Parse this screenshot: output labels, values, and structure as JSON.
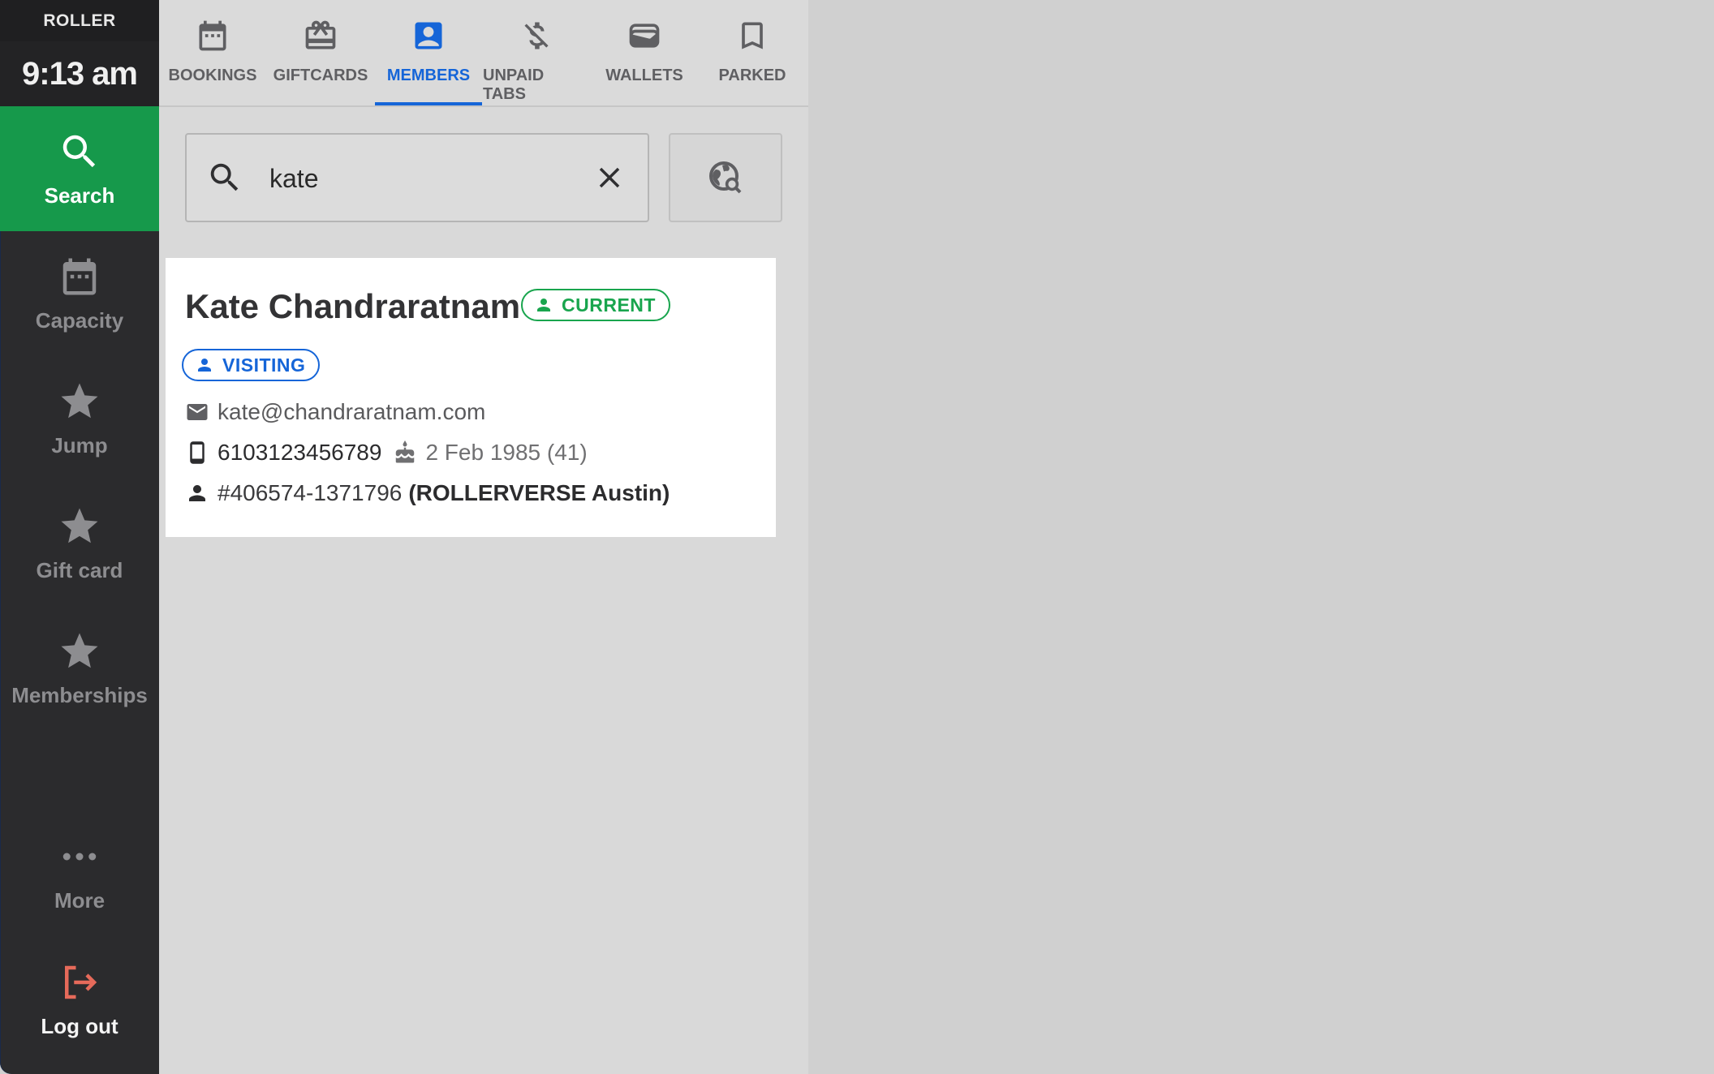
{
  "sidebar": {
    "brand": "ROLLER",
    "time": "9:13 am",
    "items": [
      {
        "label": "Search",
        "icon": "search-icon"
      },
      {
        "label": "Capacity",
        "icon": "calendar-icon"
      },
      {
        "label": "Jump",
        "icon": "star-icon"
      },
      {
        "label": "Gift card",
        "icon": "star-icon"
      },
      {
        "label": "Memberships",
        "icon": "star-icon"
      },
      {
        "label": "More",
        "icon": "more-dots-icon"
      },
      {
        "label": "Log out",
        "icon": "logout-icon"
      }
    ],
    "active_color": "#16994b",
    "logout_color": "#e66a5a"
  },
  "tabs": [
    {
      "label": "BOOKINGS",
      "icon": "calendar-icon"
    },
    {
      "label": "GIFTCARDS",
      "icon": "gift-card-icon"
    },
    {
      "label": "MEMBERS",
      "icon": "member-icon",
      "active": true
    },
    {
      "label": "UNPAID TABS",
      "icon": "no-money-icon"
    },
    {
      "label": "WALLETS",
      "icon": "wallet-icon"
    },
    {
      "label": "PARKED",
      "icon": "bookmark-icon"
    }
  ],
  "search": {
    "value": "kate",
    "placeholder": ""
  },
  "result": {
    "name": "Kate Chandraratnam",
    "status_badge": "CURRENT",
    "visit_badge": "VISITING",
    "email": "kate@chandraratnam.com",
    "phone": "6103123456789",
    "dob": "2 Feb 1985 (41)",
    "member_id": "#406574-1371796",
    "venue": "(ROLLERVERSE Austin)"
  },
  "colors": {
    "accent_blue": "#1565d8",
    "current_green": "#19a54e"
  }
}
